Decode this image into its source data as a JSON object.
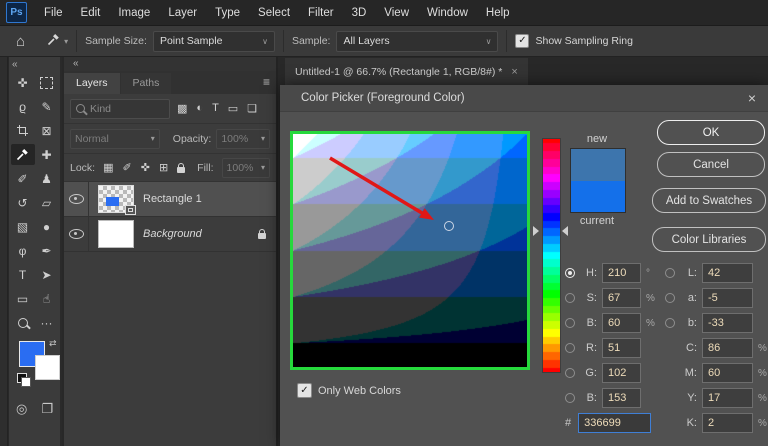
{
  "app": {
    "logo": "Ps"
  },
  "icons": {
    "check": "✓",
    "collapse": "«",
    "panel_menu": "≡",
    "dropdown": "▾",
    "chevron": "∨",
    "close": "×",
    "home": "⌂",
    "swap": "⇄",
    "quick_mask": "◎",
    "screen_mode": "❐"
  },
  "menu": {
    "items": [
      "File",
      "Edit",
      "Image",
      "Layer",
      "Type",
      "Select",
      "Filter",
      "3D",
      "View",
      "Window",
      "Help"
    ]
  },
  "options_bar": {
    "sample_size_label": "Sample Size:",
    "sample_size_value": "Point Sample",
    "sample_label": "Sample:",
    "sample_value": "All Layers",
    "show_sampling_ring_label": "Show Sampling Ring",
    "show_sampling_ring_checked": true
  },
  "document_tab": {
    "title": "Untitled-1 @ 66.7% (Rectangle 1, RGB/8#) *",
    "close": "×"
  },
  "toolbar": {
    "foreground_color": "#2a6df2",
    "background_color": "#ffffff",
    "tools": [
      {
        "name": "move-tool",
        "glyph": "✜"
      },
      {
        "name": "marquee-tool",
        "css": "marquee-icon"
      },
      {
        "name": "lasso-tool",
        "glyph": "ϱ"
      },
      {
        "name": "quick-selection-tool",
        "glyph": "✎"
      },
      {
        "name": "crop-tool",
        "css": "crop-icon"
      },
      {
        "name": "frame-tool",
        "glyph": "⊠"
      },
      {
        "name": "eyedropper-tool",
        "svg": "dropper",
        "selected": true
      },
      {
        "name": "healing-brush-tool",
        "glyph": "✚"
      },
      {
        "name": "brush-tool",
        "glyph": "✐"
      },
      {
        "name": "clone-stamp-tool",
        "glyph": "♟"
      },
      {
        "name": "history-brush-tool",
        "glyph": "↺"
      },
      {
        "name": "eraser-tool",
        "glyph": "▱"
      },
      {
        "name": "gradient-tool",
        "glyph": "▧"
      },
      {
        "name": "blur-tool",
        "glyph": "●"
      },
      {
        "name": "dodge-tool",
        "glyph": "φ"
      },
      {
        "name": "pen-tool",
        "glyph": "✒"
      },
      {
        "name": "type-tool",
        "glyph": "T"
      },
      {
        "name": "path-selection-tool",
        "glyph": "➤"
      },
      {
        "name": "rectangle-tool",
        "glyph": "▭"
      },
      {
        "name": "hand-tool",
        "glyph": "☝"
      },
      {
        "name": "zoom-tool",
        "css": "mag-icon"
      },
      {
        "name": "toolbar-more",
        "glyph": "···"
      }
    ]
  },
  "layers_panel": {
    "tabs": [
      {
        "label": "Layers"
      },
      {
        "label": "Paths"
      }
    ],
    "search_placeholder": "Kind",
    "filter_icons": [
      {
        "name": "pixel-layer-filter-icon",
        "glyph": "▩"
      },
      {
        "name": "adjustment-layer-filter-icon",
        "glyph": "◐"
      },
      {
        "name": "type-layer-filter-icon",
        "glyph": "T"
      },
      {
        "name": "shape-layer-filter-icon",
        "glyph": "▭"
      },
      {
        "name": "smart-object-filter-icon",
        "glyph": "❏"
      }
    ],
    "blend_mode": "Normal",
    "opacity_label": "Opacity:",
    "opacity_value": "100%",
    "lock_label": "Lock:",
    "fill_label": "Fill:",
    "fill_value": "100%",
    "layers": [
      {
        "name": "Rectangle 1",
        "visible": true,
        "selected": true
      },
      {
        "name": "Background",
        "visible": true,
        "locked": true
      }
    ]
  },
  "dialog": {
    "title": "Color Picker (Foreground Color)",
    "close": "×",
    "buttons": {
      "ok": "OK",
      "cancel": "Cancel",
      "add_to_swatches": "Add to Swatches",
      "color_libraries": "Color Libraries"
    },
    "swatches": {
      "new_label": "new",
      "current_label": "current",
      "new_color": "#3d75ad",
      "current_color": "#1470ea"
    },
    "picker": {
      "hue": 210,
      "saturation": 67,
      "brightness": 60,
      "only_web_colors": true,
      "annotation_border_color": "#26d93c",
      "annotation_arrow_color": "#e01717"
    },
    "fields": {
      "hsb_h": {
        "label": "H:",
        "value": "210",
        "unit": "°"
      },
      "hsb_s": {
        "label": "S:",
        "value": "67",
        "unit": "%"
      },
      "hsb_b": {
        "label": "B:",
        "value": "60",
        "unit": "%"
      },
      "rgb_r": {
        "label": "R:",
        "value": "51",
        "unit": ""
      },
      "rgb_g": {
        "label": "G:",
        "value": "102",
        "unit": ""
      },
      "rgb_b": {
        "label": "B:",
        "value": "153",
        "unit": ""
      },
      "lab_l": {
        "label": "L:",
        "value": "42",
        "unit": ""
      },
      "lab_a": {
        "label": "a:",
        "value": "-5",
        "unit": ""
      },
      "lab_b": {
        "label": "b:",
        "value": "-33",
        "unit": ""
      },
      "cmyk_c": {
        "label": "C:",
        "value": "86",
        "unit": "%"
      },
      "cmyk_m": {
        "label": "M:",
        "value": "60",
        "unit": "%"
      },
      "cmyk_y": {
        "label": "Y:",
        "value": "17",
        "unit": "%"
      },
      "cmyk_k": {
        "label": "K:",
        "value": "2",
        "unit": "%"
      },
      "hex": {
        "label": "#",
        "value": "336699"
      }
    },
    "only_web_colors_label": "Only Web Colors"
  }
}
